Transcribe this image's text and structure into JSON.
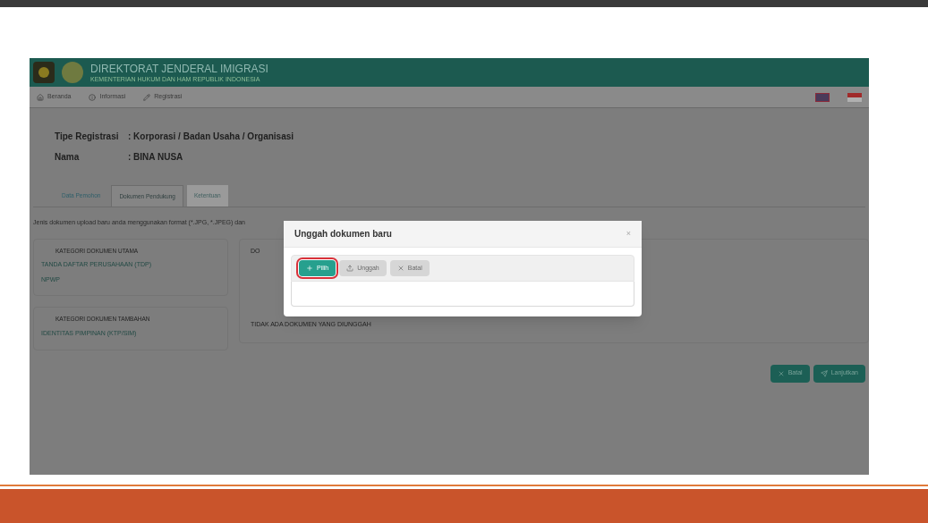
{
  "header": {
    "title": "DIREKTORAT JENDERAL IMIGRASI",
    "subtitle": "KEMENTERIAN HUKUM DAN HAM REPUBLIK INDONESIA"
  },
  "nav": [
    {
      "label": "Beranda"
    },
    {
      "label": "Informasi"
    },
    {
      "label": "Registrasi"
    }
  ],
  "summary": [
    {
      "label": "Tipe Registrasi",
      "value": ": Korporasi / Badan Usaha / Organisasi"
    },
    {
      "label": "Nama",
      "value": ": BINA NUSA"
    }
  ],
  "tabs": [
    {
      "label": "Data Pemohon",
      "selected": false
    },
    {
      "label": "Dokumen Pendukung",
      "selected": true
    },
    {
      "label": "Ketentuan",
      "selected": false
    }
  ],
  "note": "Jenis dokumen upload baru anda menggunakan format (*.JPG, *.JPEG) dan",
  "categories": [
    {
      "title": "KATEGORI DOKUMEN UTAMA",
      "items": [
        "TANDA DAFTAR PERUSAHAAN (TDP)",
        "NPWP"
      ]
    },
    {
      "title": "KATEGORI DOKUMEN TAMBAHAN",
      "items": [
        "IDENTITAS PIMPINAN (KTP/SIM)"
      ]
    }
  ],
  "documents": {
    "heading": "DO",
    "empty": "TIDAK ADA DOKUMEN YANG DIUNGGAH"
  },
  "actions": [
    {
      "label": "Batal"
    },
    {
      "label": "Lanjutkan"
    }
  ],
  "modal": {
    "title": "Unggah dokumen baru",
    "close": "×",
    "buttons": [
      {
        "label": "Pilih",
        "disabled": false,
        "highlighted": true
      },
      {
        "label": "Unggah",
        "disabled": true,
        "highlighted": false
      },
      {
        "label": "Batal",
        "disabled": true,
        "highlighted": false
      }
    ]
  }
}
